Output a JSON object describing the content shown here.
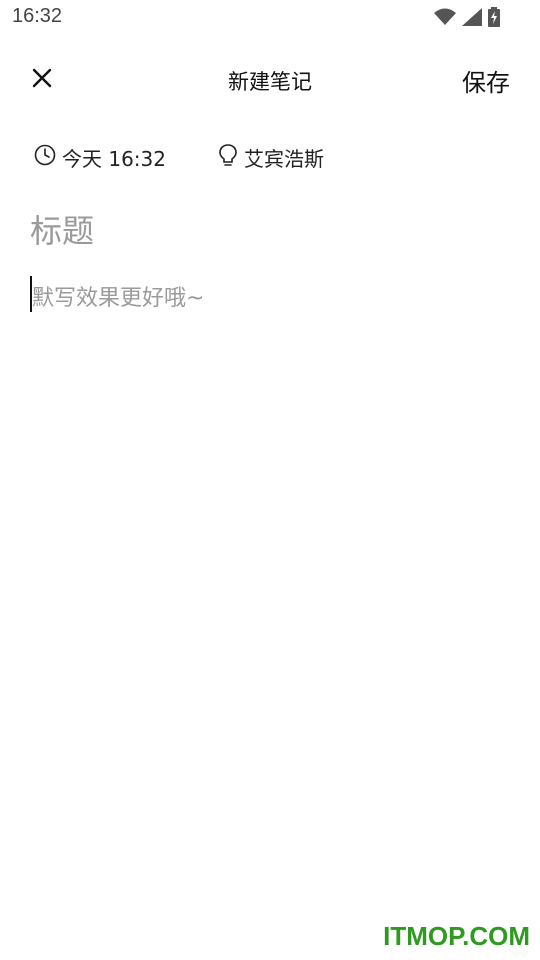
{
  "status_bar": {
    "time": "16:32",
    "icons": [
      "wifi-icon",
      "signal-icon",
      "battery-charging-icon"
    ]
  },
  "toolbar": {
    "close_icon": "close-icon",
    "title": "新建笔记",
    "save_label": "保存"
  },
  "meta": {
    "time_icon": "clock-icon",
    "time_text": "今天 16:32",
    "location_icon": "lightbulb-icon",
    "location_text": "艾宾浩斯"
  },
  "editor": {
    "title_placeholder": "标题",
    "body_placeholder": "默写效果更好哦~"
  },
  "watermark": "ITMOP.COM",
  "colors": {
    "text": "#111111",
    "placeholder": "#9a9a9a",
    "watermark": "#2e9a1f"
  }
}
